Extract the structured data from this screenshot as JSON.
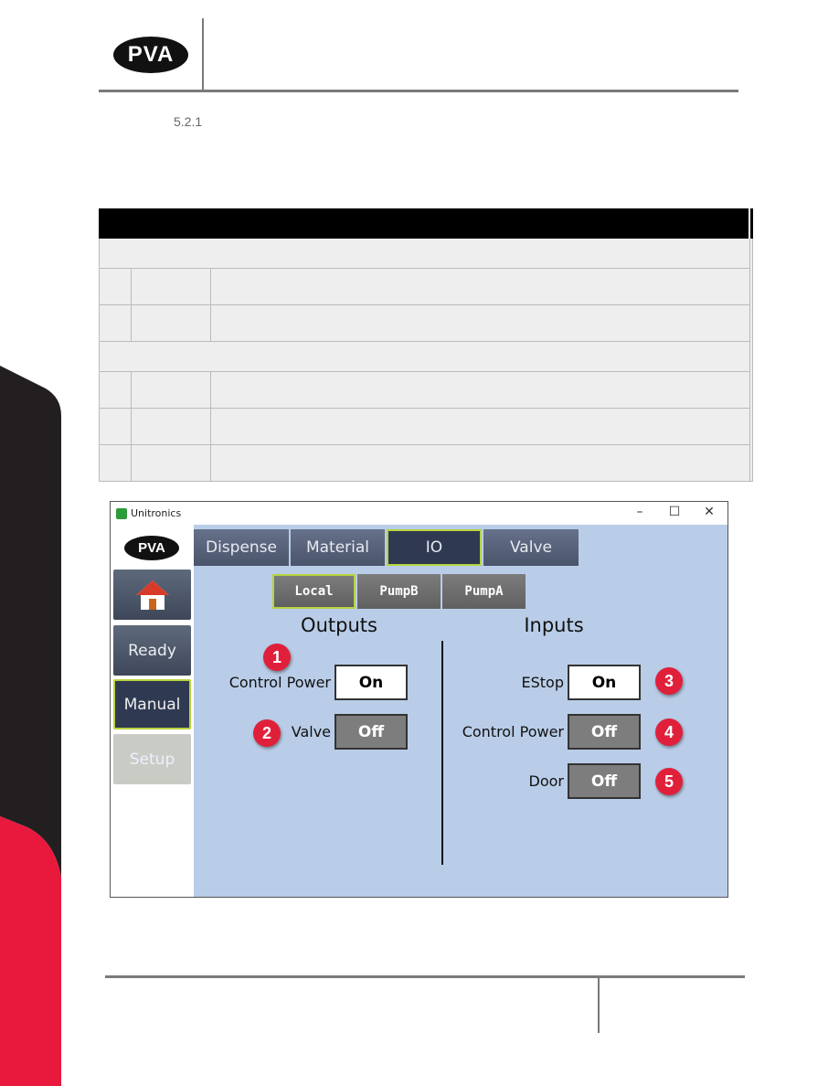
{
  "header": {
    "logo_text": "PVA",
    "section_number": "5.2.1"
  },
  "colors": {
    "band_black": "#231f20",
    "band_red": "#e8193c",
    "app_bg": "#b9cde8",
    "highlight": "#b7d33e",
    "badge": "#e0203a"
  },
  "app": {
    "window_title": "Unitronics",
    "window_controls": {
      "minimize": "–",
      "maximize": "☐",
      "close": "✕"
    },
    "logo_text": "PVA",
    "sidebar": [
      {
        "label": "",
        "icon": "home-icon"
      },
      {
        "label": "Ready"
      },
      {
        "label": "Manual",
        "active": true
      },
      {
        "label": "Setup",
        "disabled": true
      }
    ],
    "tabs": [
      {
        "label": "Dispense"
      },
      {
        "label": "Material"
      },
      {
        "label": "IO",
        "active": true
      },
      {
        "label": "Valve"
      }
    ],
    "subtabs": [
      {
        "label": "Local",
        "active": true
      },
      {
        "label": "PumpB"
      },
      {
        "label": "PumpA"
      }
    ],
    "outputs": {
      "title": "Outputs",
      "items": [
        {
          "label": "Control Power",
          "state": "On",
          "badge": "1"
        },
        {
          "label": "Valve",
          "state": "Off",
          "badge": "2"
        }
      ]
    },
    "inputs": {
      "title": "Inputs",
      "items": [
        {
          "label": "EStop",
          "state": "On",
          "badge": "3"
        },
        {
          "label": "Control Power",
          "state": "Off",
          "badge": "4"
        },
        {
          "label": "Door",
          "state": "Off",
          "badge": "5"
        }
      ]
    }
  }
}
